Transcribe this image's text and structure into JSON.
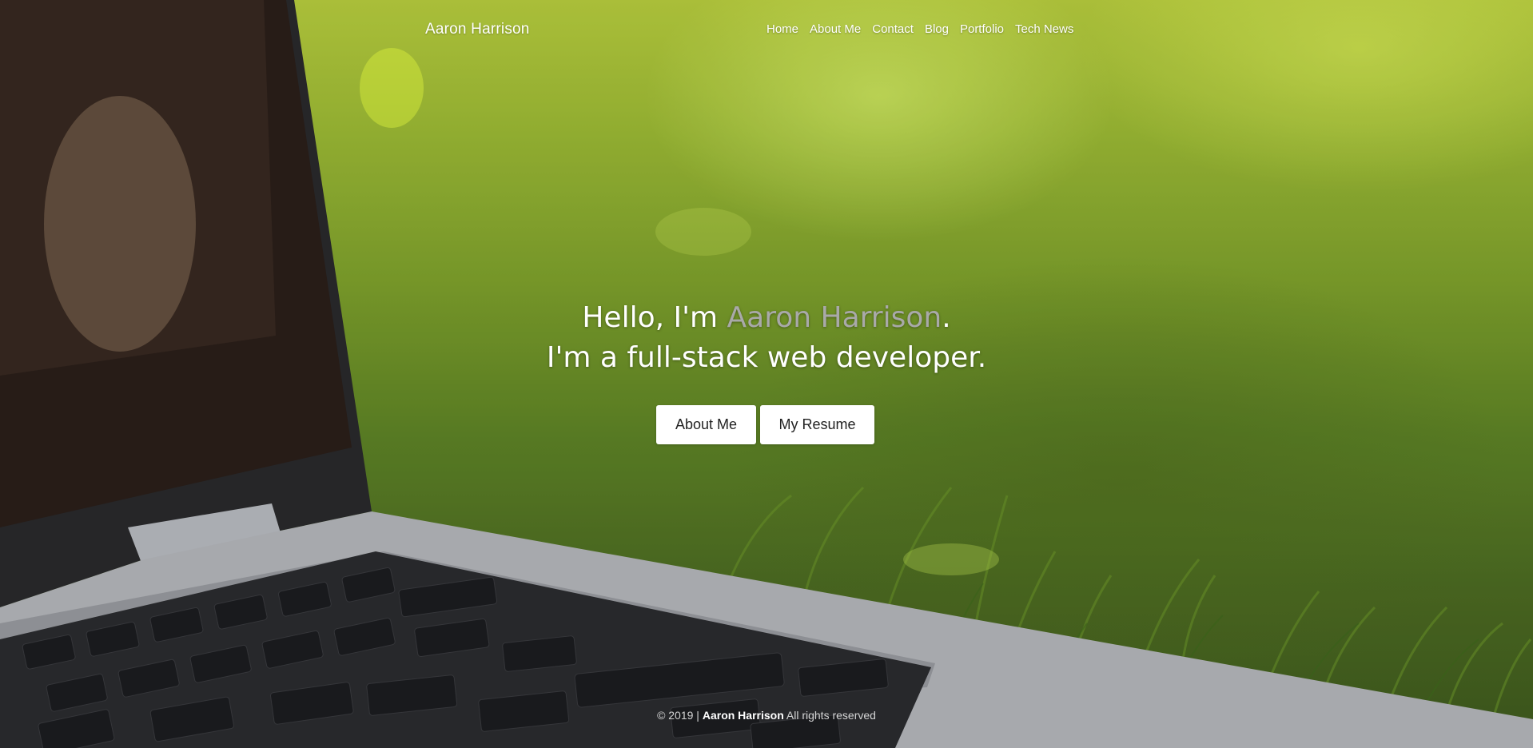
{
  "brand": "Aaron Harrison",
  "nav": {
    "items": [
      "Home",
      "About Me",
      "Contact",
      "Blog",
      "Portfolio",
      "Tech News"
    ]
  },
  "hero": {
    "line1_prefix": "Hello, I'm ",
    "line1_name": "Aaron Harrison",
    "line1_suffix": ".",
    "line2": "I'm a full-stack web developer.",
    "buttons": {
      "about": "About Me",
      "resume": "My Resume"
    }
  },
  "footer": {
    "copyright": "© 2019 |",
    "name": "Aaron Harrison",
    "rights": "All rights reserved"
  },
  "colors": {
    "name_highlight": "#a9a9a9",
    "button_bg": "#ffffff",
    "text": "#ffffff"
  }
}
